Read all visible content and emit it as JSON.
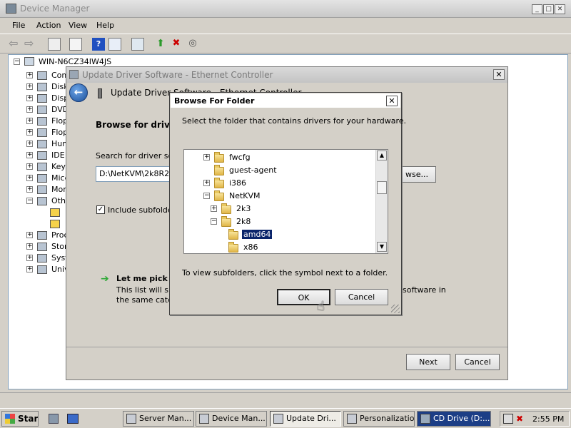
{
  "device_manager": {
    "title": "Device Manager",
    "menu": [
      "File",
      "Action",
      "View",
      "Help"
    ],
    "tree_root": "WIN-N6CZ34IW4JS",
    "tree_items": [
      "Com",
      "Disk",
      "Disp",
      "DVD",
      "Flop",
      "Flop",
      "Hum",
      "IDE",
      "Key",
      "Mice",
      "Mon",
      "Oth",
      "",
      "",
      "Proc",
      "Stor",
      "Syst",
      "Univ"
    ]
  },
  "update_driver": {
    "title": "Update Driver Software - Ethernet Controller",
    "header": "Update Driver Software - Ethernet Controller",
    "browse_heading": "Browse for driver s",
    "search_label": "Search for driver sof",
    "path_value": "D:\\NetKVM\\2k8R2",
    "browse_button": "wse...",
    "include_subfolders": "Include subfolde",
    "let_me_pick": "Let me pick fr",
    "list_text_1": "This list will show",
    "list_text_1_tail": "software in",
    "list_text_2": "the same categ",
    "next_button": "Next",
    "cancel_button": "Cancel"
  },
  "browse_folder": {
    "title": "Browse For Folder",
    "instruction": "Select the folder that contains drivers for your hardware.",
    "folders": [
      {
        "label": "fwcfg",
        "expander": "+",
        "level": 0
      },
      {
        "label": "guest-agent",
        "expander": "",
        "level": 0
      },
      {
        "label": "i386",
        "expander": "+",
        "level": 0
      },
      {
        "label": "NetKVM",
        "expander": "−",
        "level": 0
      },
      {
        "label": "2k3",
        "expander": "+",
        "level": 1
      },
      {
        "label": "2k8",
        "expander": "−",
        "level": 1
      },
      {
        "label": "amd64",
        "expander": "",
        "level": 2,
        "selected": true
      },
      {
        "label": "x86",
        "expander": "",
        "level": 2
      }
    ],
    "hint": "To view subfolders, click the symbol next to a folder.",
    "ok_button": "OK",
    "cancel_button": "Cancel"
  },
  "taskbar": {
    "start": "Start",
    "tasks": [
      "Server Man...",
      "Device Man...",
      "Update Dri...",
      "Personalization",
      "CD Drive (D:..."
    ],
    "clock": "2:55 PM"
  },
  "colors": {
    "selection": "#0a246a",
    "tree_border": "#7f9db9",
    "arrow_green": "#2ea836"
  }
}
